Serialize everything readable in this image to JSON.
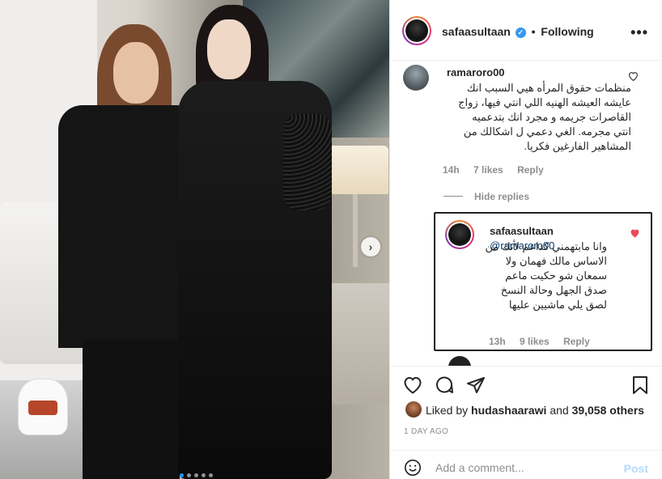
{
  "post": {
    "username": "safaasultaan",
    "following_label": "Following",
    "dot": "•",
    "more": "•••"
  },
  "comment": {
    "username": "ramaroro00",
    "text": "منظمات حقوق المرأه هيي السبب انك عايشه العيشه الهنيه اللي انتي فيها، زواج القاصرات جريمه و مجرد انك بتدعميه انتي مجرمه. الغي دعمي ل اشكالك من المشاهير الفارغين فكريا.",
    "time": "14h",
    "likes": "7 likes",
    "reply_label": "Reply",
    "hide_replies": "Hide replies"
  },
  "reply": {
    "username": "safaasultaan",
    "mention": "@ramaroro00",
    "text": "وانا مابتهمني كداعم لأنك من الاساس مالك فهمان ولا سمعان شو حكيت ماعم صدق الجهل وحالة النسخ لصق يلي ماشيين عليها",
    "time": "13h",
    "likes": "9 likes",
    "reply_label": "Reply"
  },
  "likes": {
    "prefix": "Liked by",
    "user": "hudashaarawi",
    "conj": "and",
    "others": "39,058 others"
  },
  "date": "1 DAY AGO",
  "add_comment": {
    "placeholder": "Add a comment...",
    "post_label": "Post"
  },
  "icons": {
    "next": "›"
  },
  "colors": {
    "verified": "#3897f0",
    "liked_heart": "#ed4956",
    "post_disabled": "#b3dbff",
    "carousel_active": "#2196f3"
  }
}
